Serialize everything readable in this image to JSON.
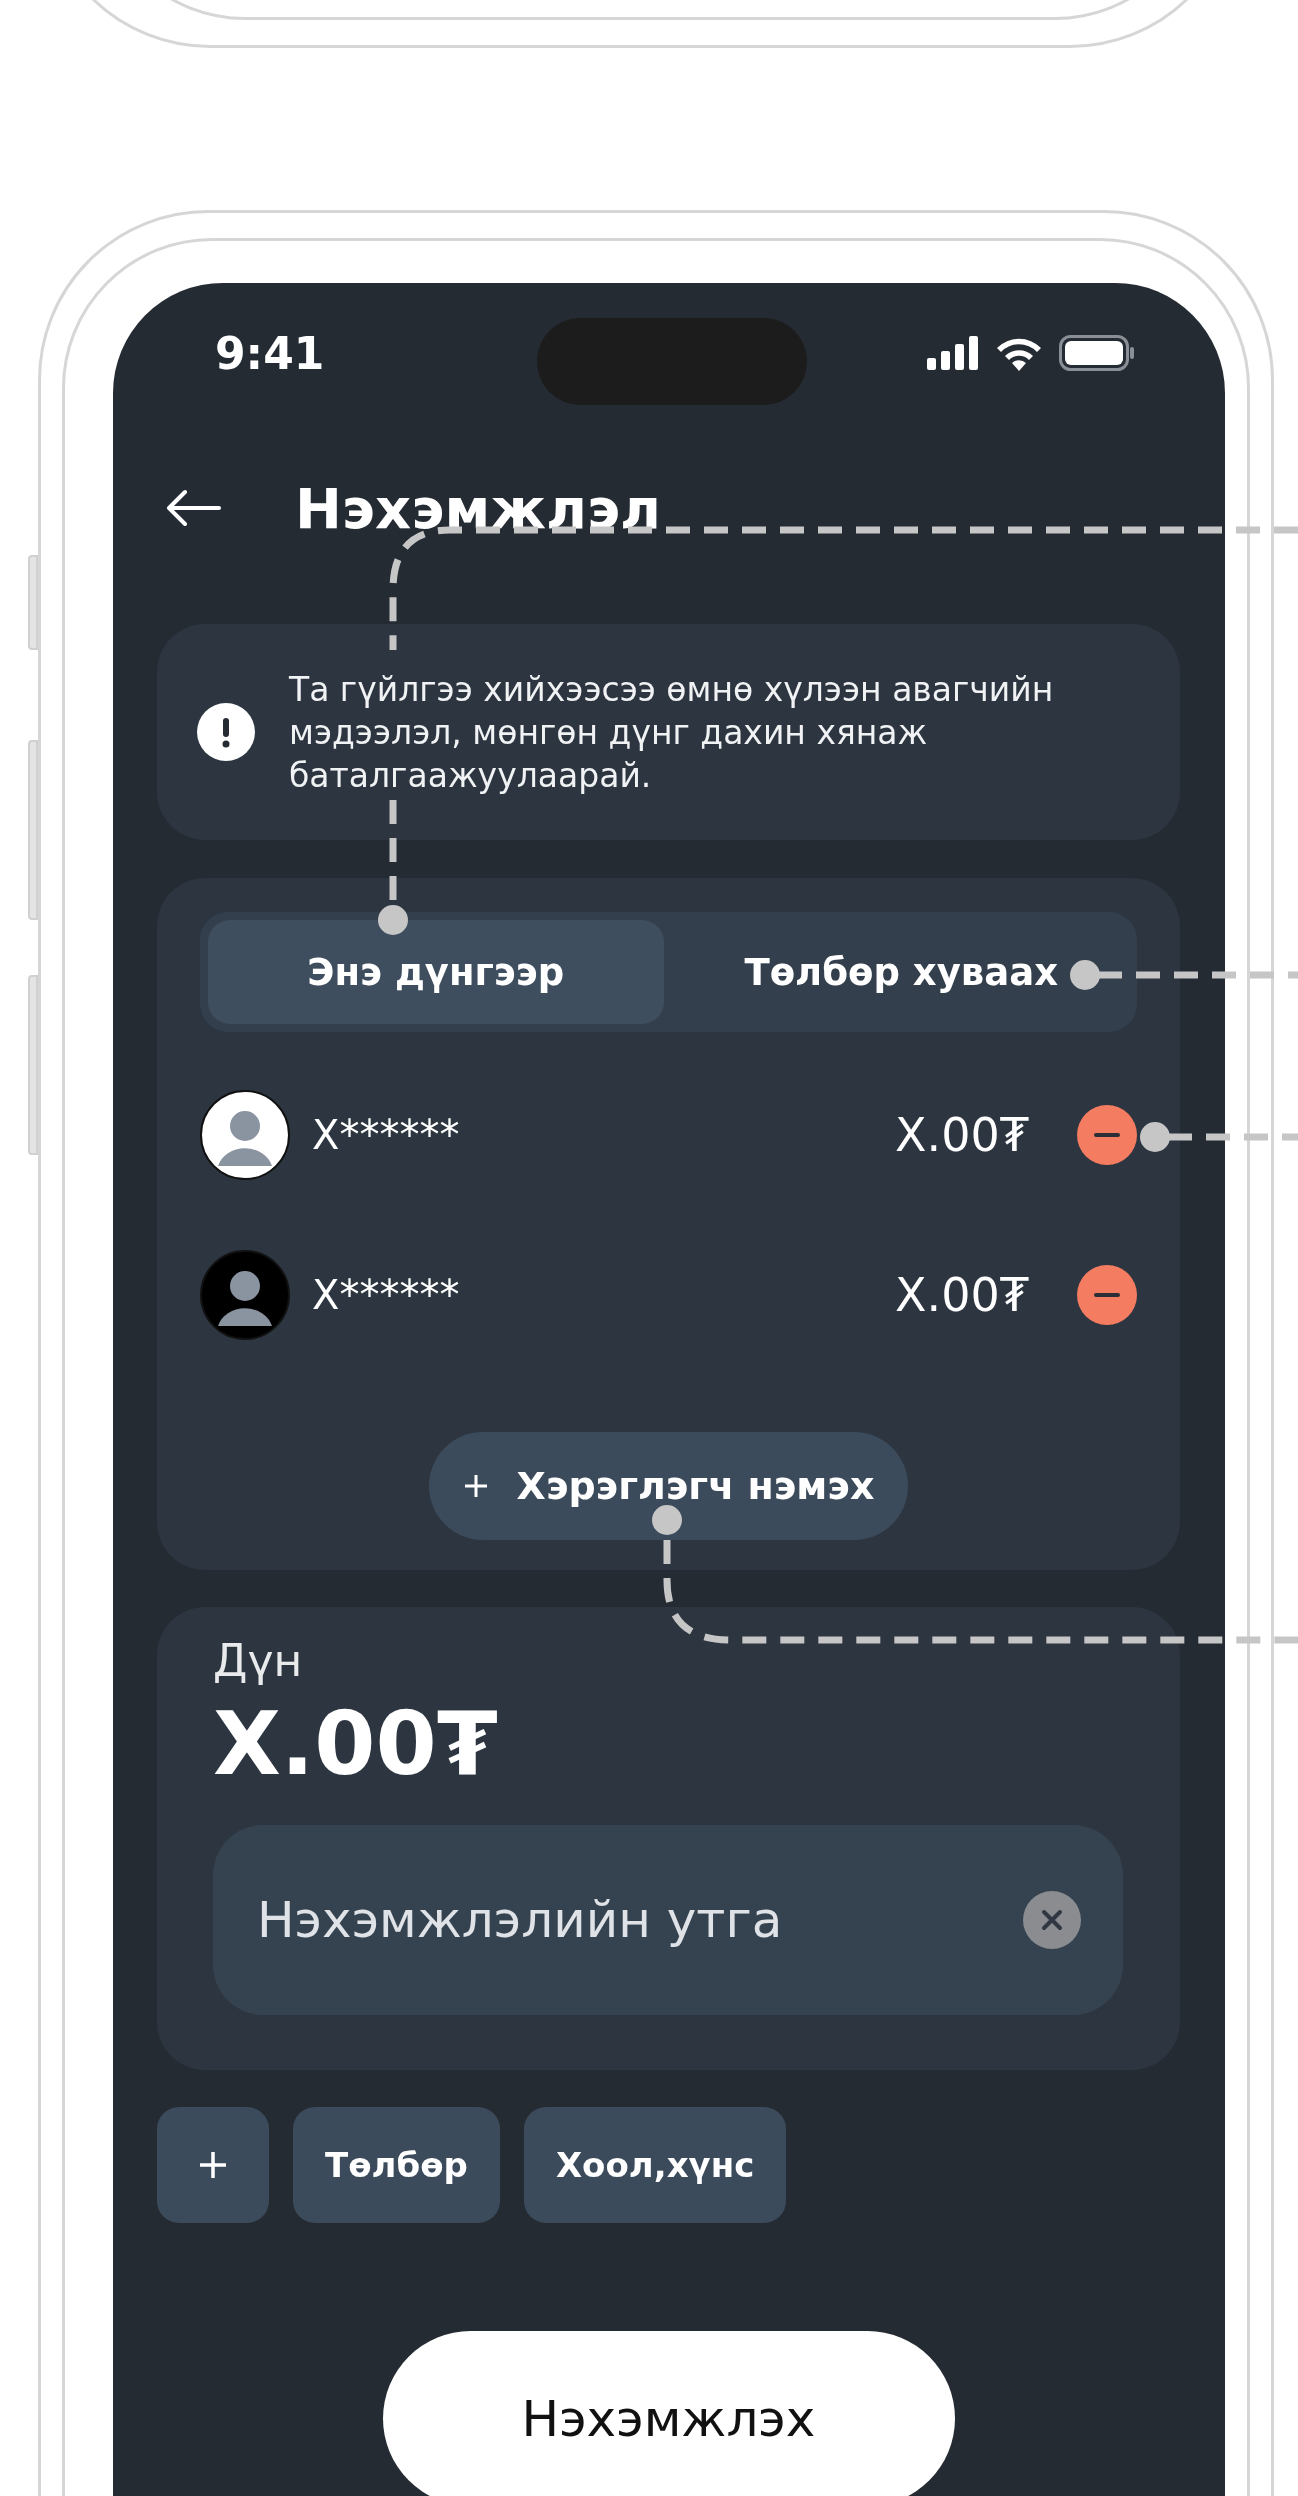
{
  "status_bar": {
    "time": "9:41"
  },
  "header": {
    "title": "Нэхэмжлэл"
  },
  "notice": {
    "text": "Та гүйлгээ хийхээсээ өмнө хүлээн авагчийн мэдээлэл, мөнгөн дүнг дахин хянаж баталгаажуулаарай."
  },
  "split_tabs": [
    {
      "label": "Энэ дүнгээр",
      "selected": true
    },
    {
      "label": "Төлбөр хуваах",
      "selected": false
    }
  ],
  "recipients": [
    {
      "name": "X******",
      "amount": "X.00₮"
    },
    {
      "name": "X******",
      "amount": "X.00₮"
    }
  ],
  "add_user_button": {
    "label": "Хэрэглэгч нэмэх"
  },
  "amount": {
    "label": "Дүн",
    "value": "X.00₮"
  },
  "description_field": {
    "placeholder": "Нэхэмжлэлийн утга"
  },
  "tags": [
    {
      "kind": "add"
    },
    {
      "kind": "tag",
      "label": "Төлбөр"
    },
    {
      "kind": "tag",
      "label": "Хоол,хүнс"
    }
  ],
  "submit_button": {
    "label": "Нэхэмжлэх"
  }
}
